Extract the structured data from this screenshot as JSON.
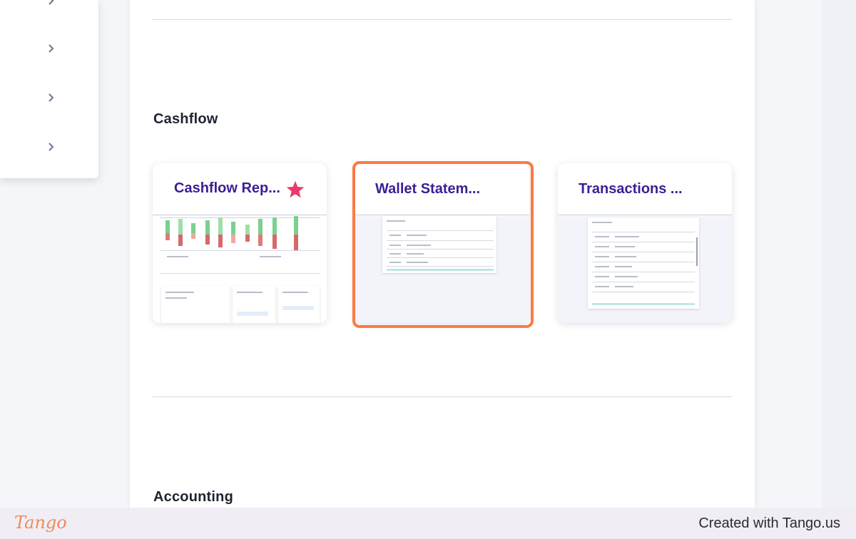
{
  "sections": {
    "cashflow_title": "Cashflow",
    "accounting_title": "Accounting"
  },
  "cards": [
    {
      "title": "Cashflow Rep...",
      "favorite": true
    },
    {
      "title": "Wallet Statem...",
      "favorite": false
    },
    {
      "title": "Transactions ...",
      "favorite": false
    }
  ],
  "footer": {
    "logo": "Tango",
    "credit": "Created with Tango.us"
  },
  "colors": {
    "card_title": "#3b1e96",
    "star": "#e83b6b",
    "highlight": "#fb7a45"
  },
  "icons": {
    "sidebar_chevron": "chevron-right-icon",
    "favorite": "star-icon"
  }
}
